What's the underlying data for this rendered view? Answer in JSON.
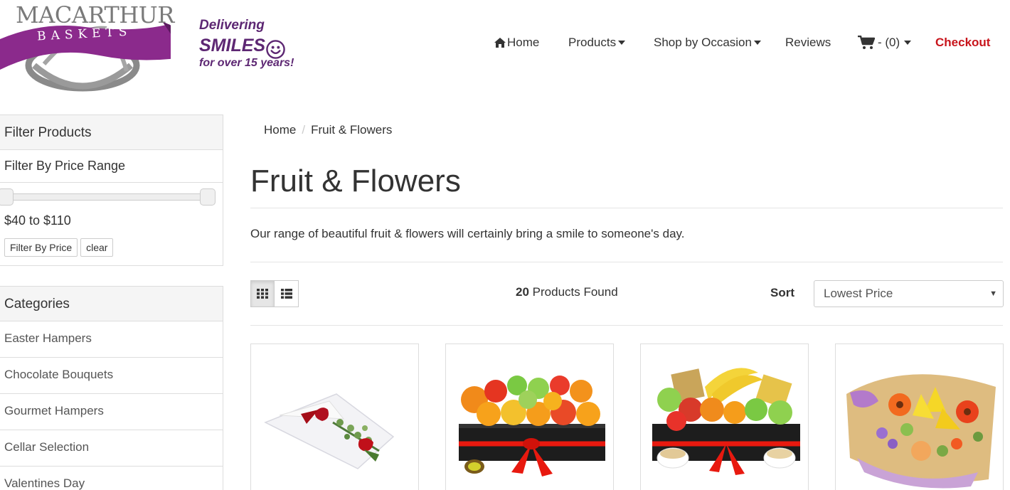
{
  "header": {
    "logo": {
      "wordmark": "MACARTHUR",
      "banner": "BASKETS"
    },
    "tagline": {
      "line1": "Delivering",
      "line2": "SMILES",
      "line3": "for over 15 years!"
    },
    "nav": {
      "home": "Home",
      "products": "Products",
      "occasion": "Shop by Occasion",
      "reviews": "Reviews",
      "cart": "- (0)",
      "checkout": "Checkout"
    }
  },
  "sidebar": {
    "filter": {
      "heading": "Filter Products",
      "price_heading": "Filter By Price Range",
      "price_range": "$40 to $110",
      "filter_button": "Filter By Price",
      "clear_button": "clear"
    },
    "categories": {
      "heading": "Categories",
      "items": [
        {
          "label": "Easter Hampers"
        },
        {
          "label": "Chocolate Bouquets"
        },
        {
          "label": "Gourmet Hampers"
        },
        {
          "label": "Cellar Selection"
        },
        {
          "label": "Valentines Day"
        }
      ]
    }
  },
  "main": {
    "breadcrumb": {
      "home": "Home",
      "separator": "/",
      "current": "Fruit & Flowers"
    },
    "title": "Fruit & Flowers",
    "description": "Our range of beautiful fruit & flowers will certainly bring a smile to someone's day.",
    "toolbar": {
      "count": "20",
      "count_label": "Products Found",
      "sort_label": "Sort",
      "sort_value": "Lowest Price"
    }
  },
  "colors": {
    "brand_purple": "#5d2773",
    "checkout_red": "#c8141b",
    "panel_bg": "#f5f5f5",
    "border": "#dddddd"
  }
}
